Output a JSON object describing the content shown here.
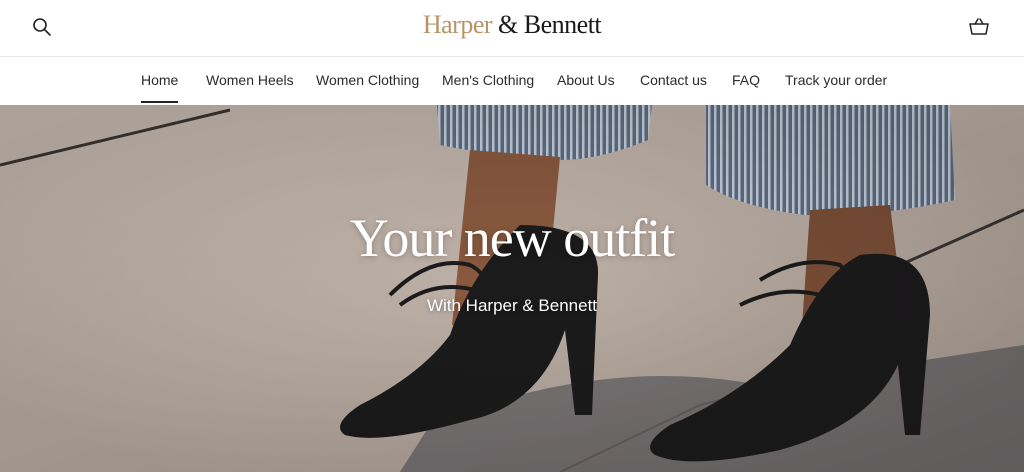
{
  "header": {
    "logo_part1": "Harper",
    "logo_part2": " & Bennett",
    "search_icon": "search-icon",
    "cart_icon": "basket-icon"
  },
  "nav": {
    "items": [
      {
        "label": "Home",
        "active": true
      },
      {
        "label": "Women Heels"
      },
      {
        "label": "Women Clothing"
      },
      {
        "label": "Men's Clothing"
      },
      {
        "label": "About Us"
      },
      {
        "label": "Contact us"
      },
      {
        "label": "FAQ"
      },
      {
        "label": "Track your order"
      }
    ]
  },
  "hero": {
    "title": "Your new outfit",
    "subtitle": "With Harper & Bennett"
  },
  "colors": {
    "logo_gold": "#b89467",
    "text_dark": "#2b2b2b",
    "hero_text": "#ffffff"
  }
}
